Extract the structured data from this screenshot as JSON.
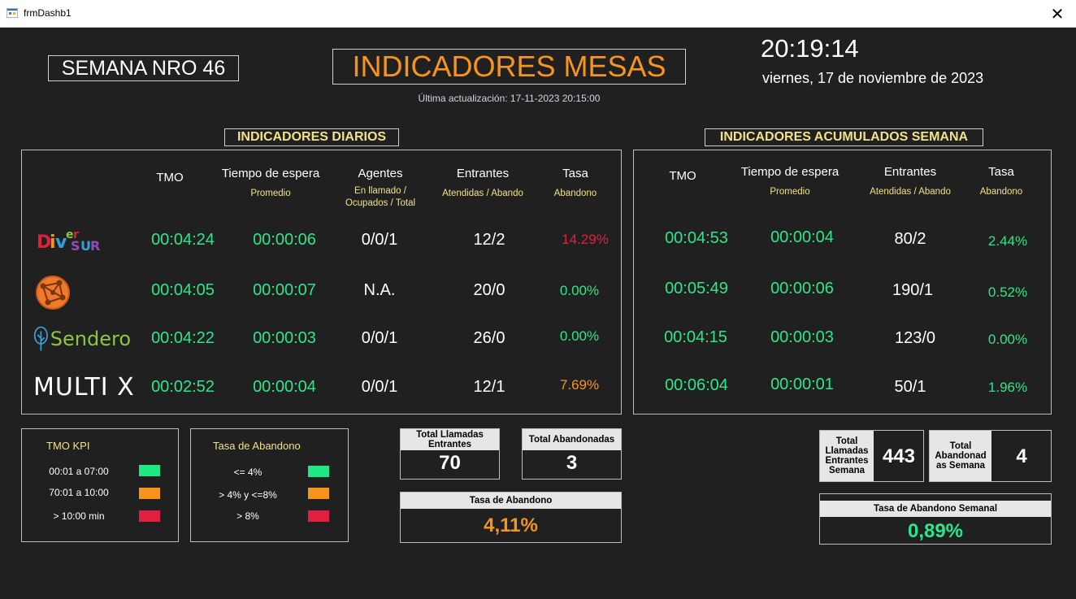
{
  "window": {
    "title": "frmDashb1",
    "close_glyph": "✕"
  },
  "header": {
    "semana": "SEMANA NRO 46",
    "title": "INDICADORES MESAS",
    "last_update": "Última actualización: 17-11-2023 20:15:00",
    "clock": "20:19:14",
    "date": "viernes, 17 de noviembre de 2023"
  },
  "daily": {
    "title": "INDICADORES DIARIOS",
    "headers": {
      "tmo": "TMO",
      "espera": "Tiempo de espera",
      "espera_sub": "Promedio",
      "agentes": "Agentes",
      "agentes_sub1": "En llamado /",
      "agentes_sub2": "Ocupados / Total",
      "entrantes": "Entrantes",
      "entrantes_sub": "Atendidas / Abando",
      "tasa": "Tasa",
      "tasa_sub": "Abandono"
    },
    "rows": [
      {
        "tmo": "00:04:24",
        "espera": "00:00:06",
        "agentes": "0/0/1",
        "entrantes": "12/2",
        "tasa": "14.29%"
      },
      {
        "tmo": "00:04:05",
        "espera": "00:00:07",
        "agentes": "N.A.",
        "entrantes": "20/0",
        "tasa": "0.00%"
      },
      {
        "tmo": "00:04:22",
        "espera": "00:00:03",
        "agentes": "0/0/1",
        "entrantes": "26/0",
        "tasa": "0.00%"
      },
      {
        "tmo": "00:02:52",
        "espera": "00:00:04",
        "agentes": "0/0/1",
        "entrantes": "12/1",
        "tasa": "7.69%"
      }
    ]
  },
  "weekly": {
    "title": "INDICADORES ACUMULADOS SEMANA",
    "headers": {
      "tmo": "TMO",
      "espera": "Tiempo de espera",
      "espera_sub": "Promedio",
      "entrantes": "Entrantes",
      "entrantes_sub": "Atendidas / Abando",
      "tasa": "Tasa",
      "tasa_sub": "Abandono"
    },
    "rows": [
      {
        "tmo": "00:04:53",
        "espera": "00:00:04",
        "entrantes": "80/2",
        "tasa": "2.44%"
      },
      {
        "tmo": "00:05:49",
        "espera": "00:00:06",
        "entrantes": "190/1",
        "tasa": "0.52%"
      },
      {
        "tmo": "00:04:15",
        "espera": "00:00:03",
        "entrantes": "123/0",
        "tasa": "0.00%"
      },
      {
        "tmo": "00:06:04",
        "espera": "00:00:01",
        "entrantes": "50/1",
        "tasa": "1.96%"
      }
    ]
  },
  "logos": {
    "diversur": {
      "chars": [
        "D",
        "i",
        "v",
        "e",
        "r",
        "S",
        "U",
        "R"
      ]
    },
    "sendero": "Sendero",
    "multix": "MULTI X"
  },
  "legend_tmo": {
    "title": "TMO KPI",
    "items": [
      {
        "label": "00:01 a 07:00",
        "color": "#1de884"
      },
      {
        "label": "70:01 a 10:00",
        "color": "#f7941d"
      },
      {
        "label": "> 10:00 min",
        "color": "#e0203c"
      }
    ]
  },
  "legend_tasa": {
    "title": "Tasa de Abandono",
    "items": [
      {
        "label": "<= 4%",
        "color": "#1de884"
      },
      {
        "label": "> 4%  y  <=8%",
        "color": "#f7941d"
      },
      {
        "label": "> 8%",
        "color": "#e0203c"
      }
    ]
  },
  "totals_daily": {
    "entrantes_label": "Total Llamadas Entrantes",
    "entrantes_value": "70",
    "abandonadas_label": "Total Abandonadas",
    "abandonadas_value": "3",
    "tasa_label": "Tasa de Abandono",
    "tasa_value": "4,11%"
  },
  "totals_weekly": {
    "entrantes_label": "Total Llamadas Entrantes Semana",
    "entrantes_value": "443",
    "abandonadas_label": "Total Abandonad as Semana",
    "abandonadas_value": "4",
    "tasa_label": "Tasa de Abandono Semanal",
    "tasa_value": "0,89%"
  },
  "colors": {
    "green": "#2ee68a",
    "red": "#e0203c",
    "orange": "#f7941d",
    "yellow": "#f2e08a",
    "background": "#202020"
  }
}
